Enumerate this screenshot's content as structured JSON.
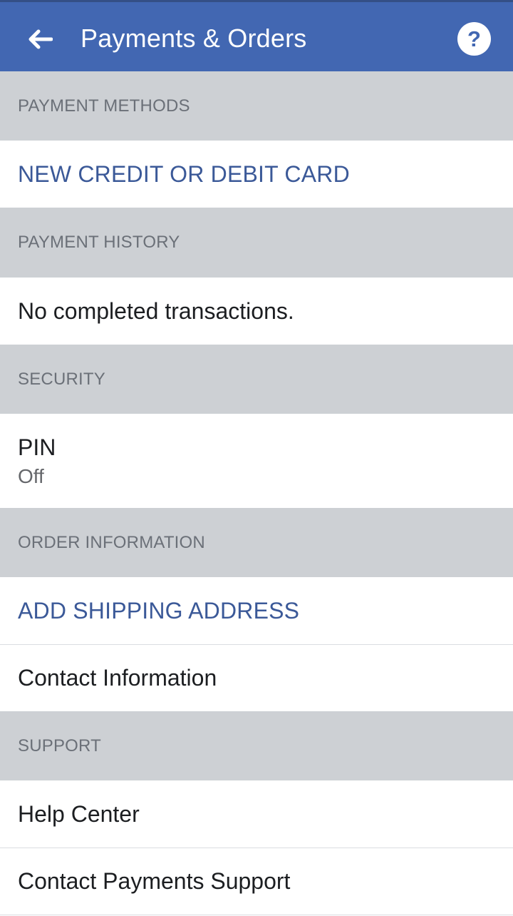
{
  "header": {
    "title": "Payments & Orders",
    "back_icon": "arrow-left-icon",
    "help_icon": "question-circle-icon",
    "help_glyph": "?"
  },
  "sections": {
    "payment_methods": {
      "header": "PAYMENT METHODS",
      "new_card_label": "NEW CREDIT OR DEBIT CARD"
    },
    "payment_history": {
      "header": "PAYMENT HISTORY",
      "empty_text": "No completed transactions."
    },
    "security": {
      "header": "SECURITY",
      "pin_label": "PIN",
      "pin_value": "Off"
    },
    "order_information": {
      "header": "ORDER INFORMATION",
      "add_shipping_label": "ADD SHIPPING ADDRESS",
      "contact_info_label": "Contact Information"
    },
    "support": {
      "header": "SUPPORT",
      "help_center_label": "Help Center",
      "contact_support_label": "Contact Payments Support"
    }
  },
  "colors": {
    "brand_blue": "#4267b2",
    "link_blue": "#3b5998",
    "section_gray": "#cdd0d4"
  }
}
